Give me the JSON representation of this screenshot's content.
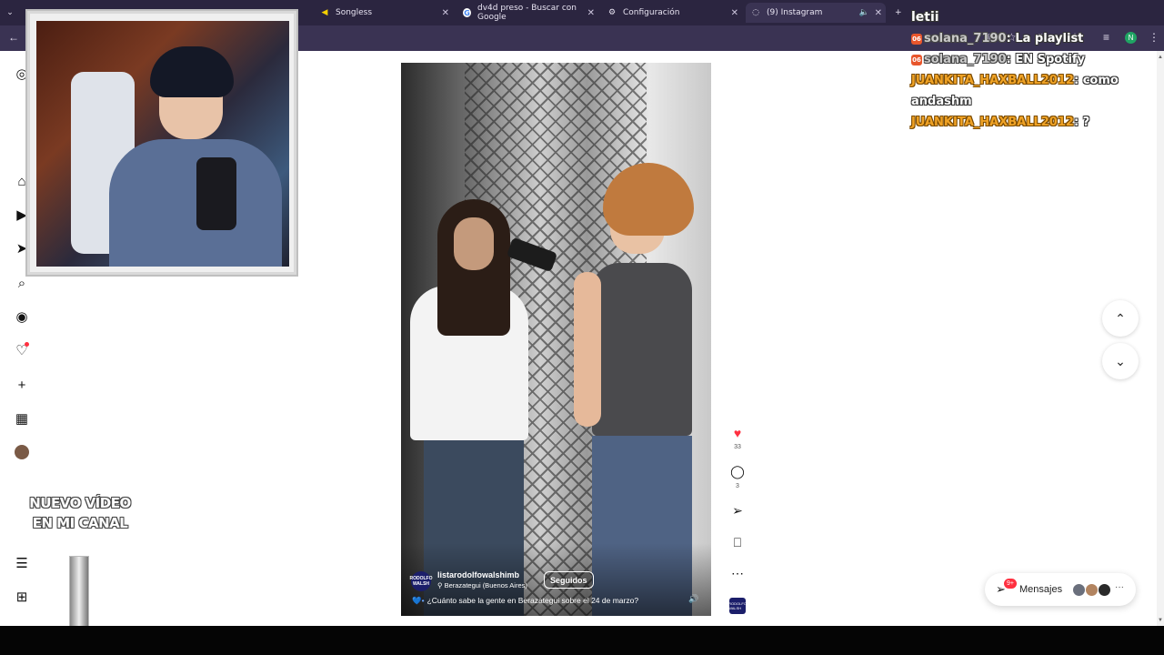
{
  "browser": {
    "tabs": [
      {
        "title": "",
        "favicon": "yellow-chevron-icon"
      },
      {
        "title": "",
        "favicon": "red-icon"
      },
      {
        "title": "Songless",
        "favicon": "songless-icon"
      },
      {
        "title": "dv4d preso - Buscar con Google",
        "favicon": "google-icon"
      },
      {
        "title": "Configuración",
        "favicon": "gear-icon"
      },
      {
        "title": "(9) Instagram",
        "favicon": "loading-icon"
      }
    ],
    "new_tab": "+",
    "profile_initial": "N"
  },
  "stream_overlay": {
    "promo_line1": "NUEVO VÍDEO",
    "promo_line2": "EN MI CANAL",
    "chat": [
      {
        "user": "letii",
        "message": "",
        "user_style": "white"
      },
      {
        "user": "solana_7190",
        "message": "La playlist",
        "badge": "06",
        "user_style": "grey"
      },
      {
        "user": "solana_7190",
        "message": "EN Spotify",
        "badge": "06",
        "user_style": "grey"
      },
      {
        "user": "JUANKITA_HAXBALL2012",
        "message": "como andashm",
        "user_style": "orange"
      },
      {
        "user": "JUANKITA_HAXBALL2012",
        "message": "?",
        "user_style": "orange"
      }
    ]
  },
  "instagram": {
    "post": {
      "author": "listarodolfowalshimb",
      "author_avatar_text": "RODOLFO WALSH",
      "location": "Berazategui (Buenos Aires)",
      "follow_state": "Seguidos",
      "caption": "¿Cuánto sabe la gente en Berazategui sobre el 24 de marzo?",
      "likes": "33",
      "comments": "3"
    },
    "messages": {
      "label": "Mensajes",
      "badge": "9+"
    }
  },
  "colors": {
    "accent_like": "#ff3040",
    "chrome": "#2b2540",
    "chat_orange": "#f0a326"
  }
}
